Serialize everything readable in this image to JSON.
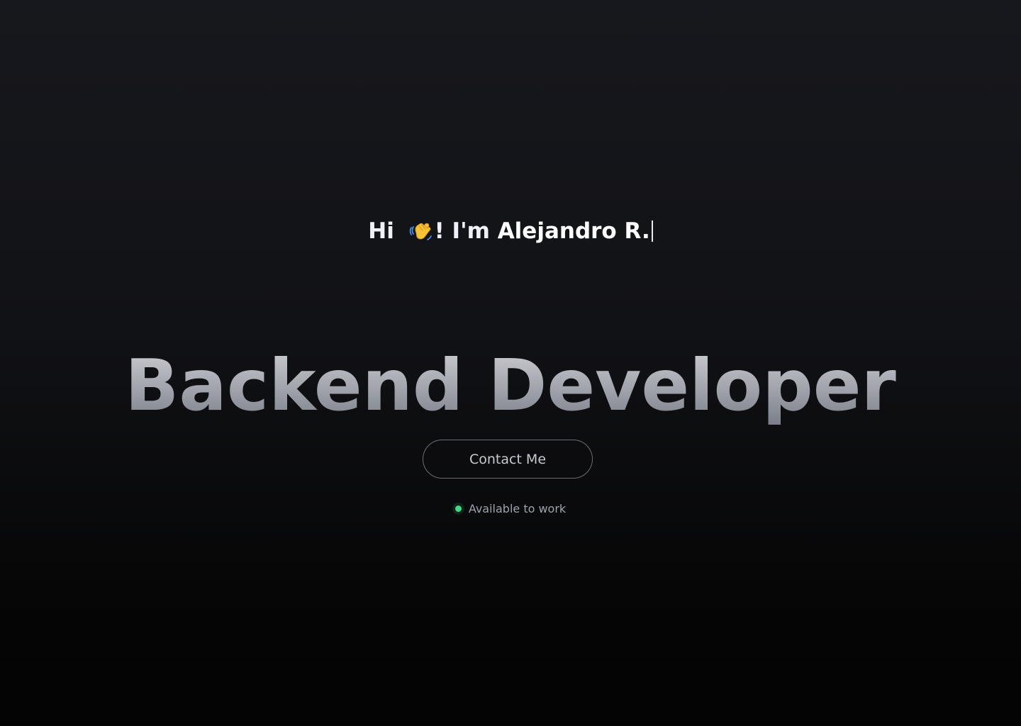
{
  "hero": {
    "greeting_prefix": "Hi",
    "greeting_suffix": "! I'm",
    "name": "Alejandro R.",
    "wave_icon": "waving-hand-icon",
    "headline": "Backend Developer",
    "contact_label": "Contact Me",
    "status_text": "Available to work",
    "status_color": "#3ddc84"
  }
}
